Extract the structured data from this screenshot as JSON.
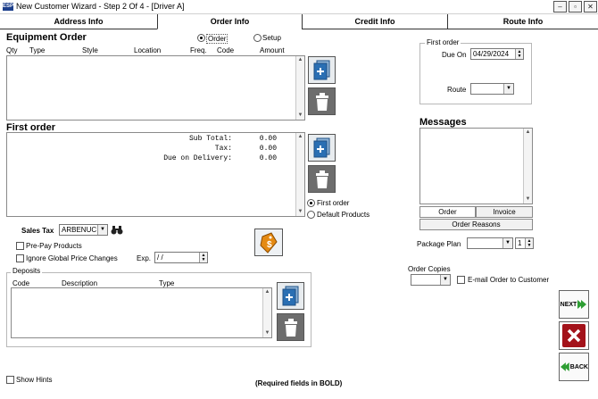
{
  "window": {
    "title": "New Customer Wizard - Step 2 Of 4 - [Driver A]",
    "logo": "ESP"
  },
  "tabs": [
    "Address Info",
    "Order Info",
    "Credit Info",
    "Route Info"
  ],
  "equipment": {
    "title": "Equipment Order",
    "radio_order": "Order",
    "radio_setup": "Setup",
    "columns": [
      "Qty",
      "Type",
      "Style",
      "Location",
      "Freq.",
      "Code",
      "Amount"
    ]
  },
  "first_order_section": {
    "title": "First order",
    "subtotal_label": "Sub Total:",
    "subtotal_value": "0.00",
    "tax_label": "Tax:",
    "tax_value": "0.00",
    "due_label": "Due on Delivery:",
    "due_value": "0.00",
    "radio_first_order": "First order",
    "radio_default_products": "Default Products"
  },
  "sales_tax": {
    "label": "Sales Tax",
    "value": "ARBENUC"
  },
  "options": {
    "prepay_label": "Pre-Pay Products",
    "ignore_label": "Ignore Global Price Changes",
    "exp_label": "Exp.",
    "exp_value": " / /"
  },
  "deposits": {
    "title": "Deposits",
    "columns": [
      "Code",
      "Description",
      "Type"
    ]
  },
  "show_hints": "Show Hints",
  "required_note": "(Required fields in BOLD)",
  "first_order_box": {
    "title": "First order",
    "due_on_label": "Due On",
    "due_on_value": "04/29/2024",
    "route_label": "Route",
    "route_value": ""
  },
  "messages": {
    "title": "Messages",
    "tab_order": "Order",
    "tab_invoice": "Invoice",
    "order_reasons": "Order Reasons"
  },
  "package_plan": {
    "label": "Package Plan",
    "value": "",
    "count": "1"
  },
  "order_copies": {
    "label": "Order Copies",
    "value": ""
  },
  "email_order_label": "E-mail Order to Customer",
  "nav": {
    "next_label": "NEXT",
    "back_label": "BACK"
  },
  "colors": {
    "accent_green": "#2e9e33",
    "cancel_red": "#a3121a",
    "doc_blue": "#2a6fb3"
  }
}
